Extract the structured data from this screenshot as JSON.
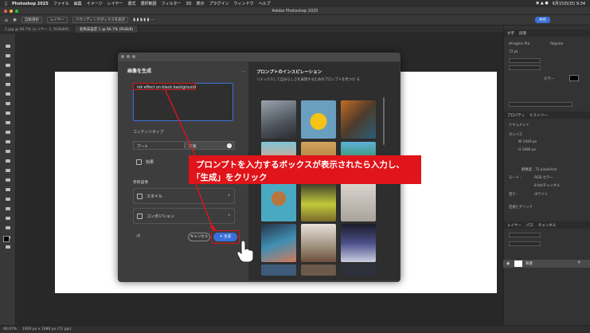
{
  "menubar": {
    "app": "Photoshop 2025",
    "items": [
      "ファイル",
      "編集",
      "イメージ",
      "レイヤー",
      "書式",
      "選択範囲",
      "フィルター",
      "3D",
      "表示",
      "プラグイン",
      "ウィンドウ",
      "ヘルプ"
    ],
    "clock": "6月15日(日) 9:34"
  },
  "window": {
    "title": "Adobe Photoshop 2025"
  },
  "options": {
    "chip1": "自動選択",
    "chip2": "レイヤー",
    "chip3": "バウンディングボックスを表示",
    "share": "共有"
  },
  "tabs": [
    "1.jpg @ 66.7% (レイヤー 1, RGB/8#)",
    "名称未設定 1 @ 66.7% (RGB/8)"
  ],
  "dialog": {
    "heading": "画像を生成",
    "more": "...",
    "prompt": "ink effect on black background",
    "content_type_label": "コンテンツタイプ",
    "content_type_options": [
      "アート",
      "写真"
    ],
    "content_type_selected": "写真",
    "effects_label": "効果",
    "reference_label": "参照画像",
    "style_label": "スタイル",
    "composition_label": "コンポジション",
    "cancel": "キャンセル",
    "generate": "生成",
    "inspiration_title": "プロンプトのインスピレーション",
    "inspiration_sub": "リミックスして自分らしさを表現するためのプロンプトを見つけ る"
  },
  "callout": {
    "line1": "プロンプトを入力するボックスが表示されたら入力し、",
    "line2": "「生成」をクリック"
  },
  "right_panel": {
    "tabs_top": [
      "文字",
      "段落"
    ],
    "font": "Hiragino Pro",
    "font_style": "Regular",
    "size": "72 pt",
    "color_label": "カラー",
    "tabs_mid": [
      "プロパティ",
      "ヒストリー"
    ],
    "doc_label": "ドキュメント",
    "canvas_label": "カンバス",
    "width": "1920 px",
    "height": "1080 px",
    "resolution": "解像度 : 72 pixel/inch",
    "mode_label": "モード :",
    "mode": "RGB カラー",
    "bits": "8 bit/チャンネル",
    "fill_label": "塗り :",
    "fill": "ホワイト",
    "guides_label": "定規とグリッド",
    "layers_tabs": [
      "レイヤー",
      "パス",
      "チャンネル"
    ],
    "layer_name": "背景"
  },
  "status": {
    "zoom": "66.67%",
    "size": "1920 px x 1080 px (72 ppi)"
  },
  "colors": {
    "accent": "#3b6fd8",
    "annotation": "#e0141a"
  }
}
